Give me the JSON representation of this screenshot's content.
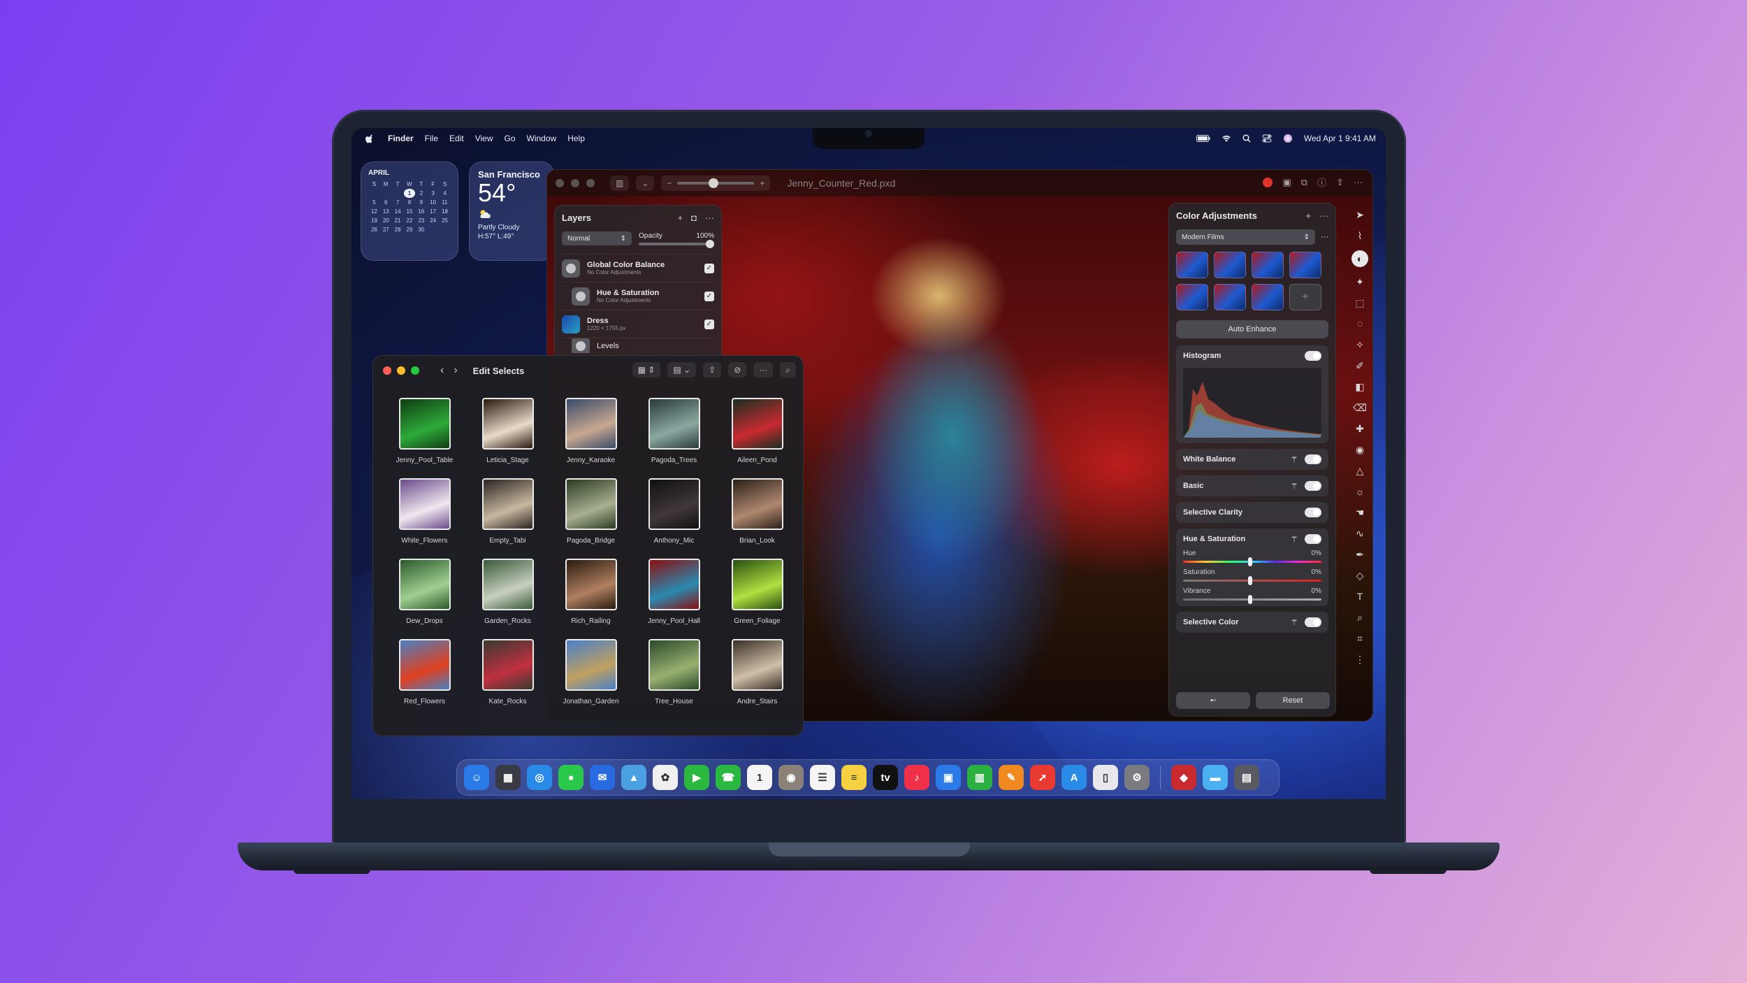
{
  "menubar": {
    "apple": "apple-logo",
    "items": [
      "Finder",
      "File",
      "Edit",
      "Window",
      "Go",
      "Window",
      "Help"
    ],
    "app_name": "Finder",
    "menu_file": "File",
    "menu_edit": "Edit",
    "menu_view": "View",
    "menu_go": "Go",
    "menu_window": "Window",
    "menu_help": "Help",
    "datetime": "Wed Apr 1  9:41 AM"
  },
  "calendar_widget": {
    "month": "APRIL",
    "weekdays": [
      "S",
      "M",
      "T",
      "W",
      "T",
      "F",
      "S"
    ],
    "weeks": [
      [
        "",
        "",
        "",
        "1",
        "2",
        "3",
        "4"
      ],
      [
        "5",
        "6",
        "7",
        "8",
        "9",
        "10",
        "11"
      ],
      [
        "12",
        "13",
        "14",
        "15",
        "16",
        "17",
        "18"
      ],
      [
        "19",
        "20",
        "21",
        "22",
        "23",
        "24",
        "25"
      ],
      [
        "26",
        "27",
        "28",
        "29",
        "30",
        "",
        ""
      ]
    ],
    "today": "1"
  },
  "weather_widget": {
    "city": "San Francisco",
    "temp": "54°",
    "condition": "Partly Cloudy",
    "range": "H:57° L:49°"
  },
  "editor": {
    "document_title": "Jenny_Counter_Red.pxd",
    "layers_panel": {
      "title": "Layers",
      "blend_mode": "Normal",
      "opacity_label": "Opacity",
      "opacity_value": "100%",
      "layers": [
        {
          "name": "Global Color Balance",
          "sub": "No Color Adjustments"
        },
        {
          "name": "Hue & Saturation",
          "sub": "No Color Adjustments"
        },
        {
          "name": "Dress",
          "sub": "1220 × 1755 px"
        },
        {
          "name": "Levels",
          "sub": ""
        }
      ]
    },
    "color_panel": {
      "title": "Color Adjustments",
      "preset": "Modern Films",
      "auto_enhance": "Auto Enhance",
      "sections": {
        "histogram": "Histogram",
        "white_balance": "White Balance",
        "basic": "Basic",
        "selective_clarity": "Selective Clarity",
        "hue_saturation": "Hue & Saturation",
        "selective_color": "Selective Color"
      },
      "sliders": [
        {
          "label": "Hue",
          "value": "0%"
        },
        {
          "label": "Saturation",
          "value": "0%"
        },
        {
          "label": "Vibrance",
          "value": "0%"
        }
      ],
      "reset": "Reset"
    }
  },
  "finder": {
    "title": "Edit Selects",
    "items": [
      {
        "name": "Jenny_Pool_Table",
        "c1": "#0f3d12",
        "c2": "#2eaa3a"
      },
      {
        "name": "Leticia_Stage",
        "c1": "#2a1810",
        "c2": "#e8dcc8"
      },
      {
        "name": "Jenny_Karaoke",
        "c1": "#3a4a6a",
        "c2": "#c8a890"
      },
      {
        "name": "Pagoda_Trees",
        "c1": "#2a3a3a",
        "c2": "#8aa8a0"
      },
      {
        "name": "Aileen_Pond",
        "c1": "#1a3020",
        "c2": "#c82a30"
      },
      {
        "name": "White_Flowers",
        "c1": "#6a4a8a",
        "c2": "#f0e8f0"
      },
      {
        "name": "Empty_Tabi",
        "c1": "#2a2420",
        "c2": "#c8b8a0"
      },
      {
        "name": "Pagoda_Bridge",
        "c1": "#2a3a20",
        "c2": "#a8b090"
      },
      {
        "name": "Anthony_Mic",
        "c1": "#101010",
        "c2": "#403838"
      },
      {
        "name": "Brian_Look",
        "c1": "#2a2018",
        "c2": "#b08870"
      },
      {
        "name": "Dew_Drops",
        "c1": "#2a5a2a",
        "c2": "#a0d090"
      },
      {
        "name": "Garden_Rocks",
        "c1": "#3a5a3a",
        "c2": "#c8d0c0"
      },
      {
        "name": "Rich_Railing",
        "c1": "#2a1a10",
        "c2": "#b08060"
      },
      {
        "name": "Jenny_Pool_Hall",
        "c1": "#8a1010",
        "c2": "#2a8ab0"
      },
      {
        "name": "Green_Foliage",
        "c1": "#2a5010",
        "c2": "#b0e040"
      },
      {
        "name": "Red_Flowers",
        "c1": "#4a80c0",
        "c2": "#e04020"
      },
      {
        "name": "Kate_Rocks",
        "c1": "#3a3a30",
        "c2": "#c03040"
      },
      {
        "name": "Jonathan_Garden",
        "c1": "#4a80c8",
        "c2": "#c0a060"
      },
      {
        "name": "Tree_House",
        "c1": "#2a4a2a",
        "c2": "#9ab070"
      },
      {
        "name": "Andre_Stairs",
        "c1": "#3a3028",
        "c2": "#d0c0a8"
      }
    ]
  },
  "dock": {
    "apps": [
      {
        "name": "finder",
        "bg": "#2a7ae8",
        "glyph": "☺"
      },
      {
        "name": "launchpad",
        "bg": "#3a3a44",
        "glyph": "▦"
      },
      {
        "name": "safari",
        "bg": "#2a8ae8",
        "glyph": "◎"
      },
      {
        "name": "messages",
        "bg": "#2ac84a",
        "glyph": "●"
      },
      {
        "name": "mail",
        "bg": "#2a6ae0",
        "glyph": "✉"
      },
      {
        "name": "maps",
        "bg": "#4aa0e0",
        "glyph": "▲"
      },
      {
        "name": "photos",
        "bg": "#f0f0f0",
        "glyph": "✿"
      },
      {
        "name": "facetime",
        "bg": "#2ab840",
        "glyph": "▶"
      },
      {
        "name": "phone",
        "bg": "#2ab840",
        "glyph": "☎"
      },
      {
        "name": "calendar",
        "bg": "#f5f5f5",
        "glyph": "1"
      },
      {
        "name": "contacts",
        "bg": "#8a8278",
        "glyph": "◉"
      },
      {
        "name": "reminders",
        "bg": "#f5f5f5",
        "glyph": "☰"
      },
      {
        "name": "notes",
        "bg": "#f5d040",
        "glyph": "≡"
      },
      {
        "name": "tv",
        "bg": "#111111",
        "glyph": "tv"
      },
      {
        "name": "music",
        "bg": "#f03048",
        "glyph": "♪"
      },
      {
        "name": "keynote",
        "bg": "#2a7ae8",
        "glyph": "▣"
      },
      {
        "name": "numbers",
        "bg": "#2ab040",
        "glyph": "▥"
      },
      {
        "name": "pages",
        "bg": "#f08a20",
        "glyph": "✎"
      },
      {
        "name": "pixelmator",
        "bg": "#e83a30",
        "glyph": "➚"
      },
      {
        "name": "app-store",
        "bg": "#2a8ae8",
        "glyph": "A"
      },
      {
        "name": "iphone-mirroring",
        "bg": "#e8e8ec",
        "glyph": "▯"
      },
      {
        "name": "system-settings",
        "bg": "#7a7a80",
        "glyph": "⚙"
      }
    ],
    "extras": [
      {
        "name": "pixelmator-pro-recent",
        "bg": "#c82a30",
        "glyph": "◆"
      },
      {
        "name": "downloads-folder",
        "bg": "#4ab0f0",
        "glyph": "▬"
      },
      {
        "name": "trash",
        "bg": "#5a5a62",
        "glyph": "▤"
      }
    ]
  },
  "colors": {
    "accent_red": "#ff5f57",
    "accent_yellow": "#febc2e",
    "accent_green": "#28c840"
  }
}
